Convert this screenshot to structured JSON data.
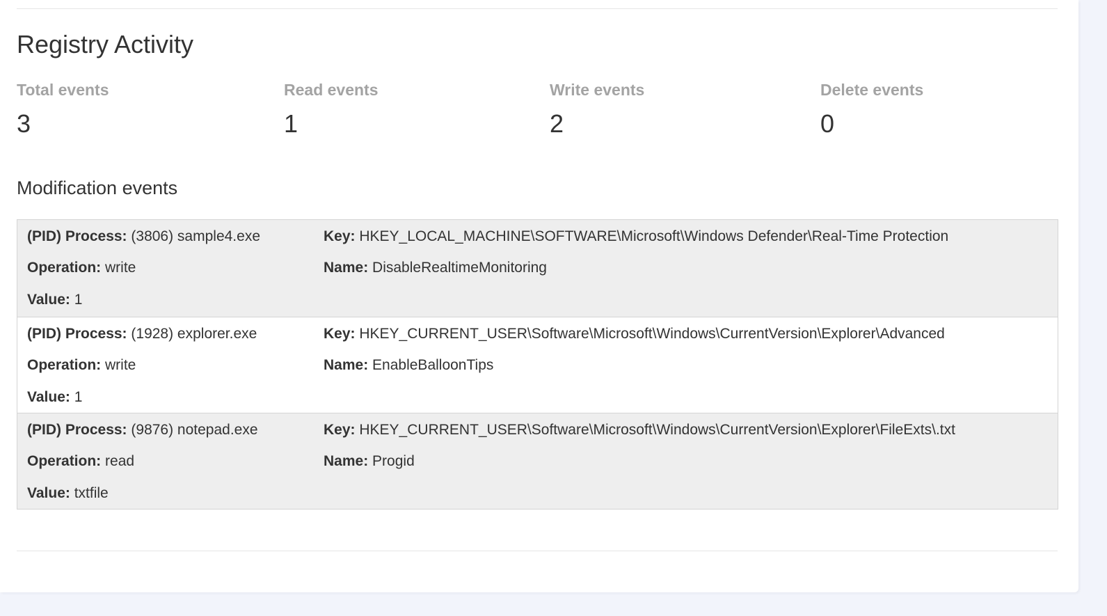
{
  "section": {
    "title": "Registry Activity"
  },
  "stats": [
    {
      "label": "Total events",
      "value": "3"
    },
    {
      "label": "Read events",
      "value": "1"
    },
    {
      "label": "Write events",
      "value": "2"
    },
    {
      "label": "Delete events",
      "value": "0"
    }
  ],
  "modifications": {
    "title": "Modification events",
    "labels": {
      "process": "(PID) Process:",
      "key": "Key:",
      "operation": "Operation:",
      "name": "Name:",
      "value": "Value:"
    },
    "events": [
      {
        "process": "(3806) sample4.exe",
        "key": "HKEY_LOCAL_MACHINE\\SOFTWARE\\Microsoft\\Windows Defender\\Real-Time Protection",
        "operation": "write",
        "name": "DisableRealtimeMonitoring",
        "value": "1"
      },
      {
        "process": "(1928) explorer.exe",
        "key": "HKEY_CURRENT_USER\\Software\\Microsoft\\Windows\\CurrentVersion\\Explorer\\Advanced",
        "operation": "write",
        "name": "EnableBalloonTips",
        "value": "1"
      },
      {
        "process": "(9876) notepad.exe",
        "key": "HKEY_CURRENT_USER\\Software\\Microsoft\\Windows\\CurrentVersion\\Explorer\\FileExts\\.txt",
        "operation": "read",
        "name": "Progid",
        "value": "txtfile"
      }
    ]
  }
}
